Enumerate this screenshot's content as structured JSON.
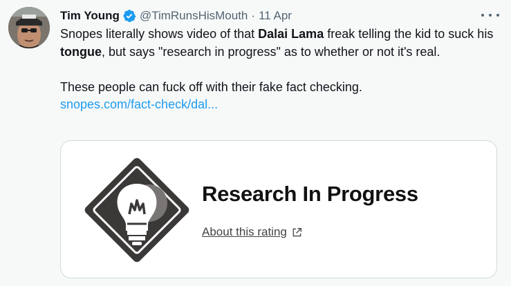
{
  "author": {
    "name": "Tim Young",
    "handle": "@TimRunsHisMouth",
    "separator": "·",
    "date": "11 Apr",
    "verified_color": "#1d9bf0"
  },
  "tweet": {
    "line1_pre": "Snopes literally shows video of that ",
    "line1_bold1": "Dalai Lama",
    "line1_mid": " freak telling the kid to suck his ",
    "line1_bold2": "tongue",
    "line1_post": ", but says \"research in progress\" as to whether or not it's real.",
    "line2": "These people can fuck off with their fake fact checking.",
    "link_text": "snopes.com/fact-check/dal..."
  },
  "card": {
    "title": "Research In Progress",
    "subtitle": "About this rating",
    "badge_icon": "lightbulb-icon"
  },
  "colors": {
    "link": "#1d9bf0",
    "secondary_text": "#536471",
    "border": "#cfd9de",
    "background": "#f7f9f9"
  }
}
